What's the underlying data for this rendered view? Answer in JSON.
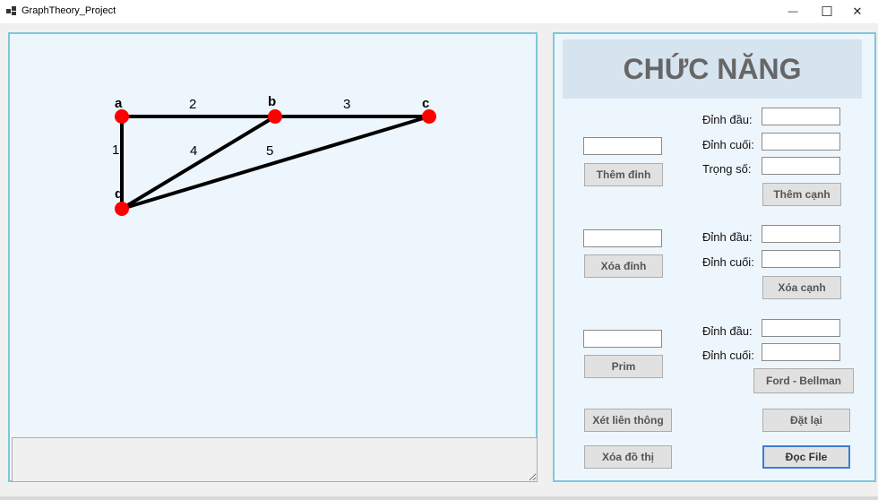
{
  "window": {
    "title": "GraphTheory_Project",
    "minimize_glyph": "—",
    "maximize_glyph": "☐",
    "close_glyph": "✕"
  },
  "graph": {
    "vertices": [
      {
        "id": "a",
        "label": "a"
      },
      {
        "id": "b",
        "label": "b"
      },
      {
        "id": "c",
        "label": "c"
      },
      {
        "id": "d",
        "label": "d"
      }
    ],
    "edges": [
      {
        "from": "a",
        "to": "b",
        "weight": "2"
      },
      {
        "from": "b",
        "to": "c",
        "weight": "3"
      },
      {
        "from": "a",
        "to": "d",
        "weight": "1"
      },
      {
        "from": "b",
        "to": "d",
        "weight": "4"
      },
      {
        "from": "c",
        "to": "d",
        "weight": "5"
      }
    ],
    "vertex_color": "#ff0000",
    "edge_color": "#000000"
  },
  "status_box": {
    "value": ""
  },
  "panel": {
    "header": "CHỨC NĂNG",
    "add_vertex": {
      "input": "",
      "button": "Thêm đỉnh"
    },
    "add_edge": {
      "start_label": "Đỉnh đầu:",
      "end_label": "Đỉnh cuối:",
      "weight_label": "Trọng số:",
      "start": "",
      "end": "",
      "weight": "",
      "button": "Thêm cạnh"
    },
    "delete_vertex": {
      "input": "",
      "button": "Xóa đỉnh"
    },
    "delete_edge": {
      "start_label": "Đỉnh đầu:",
      "end_label": "Đỉnh cuối:",
      "start": "",
      "end": "",
      "button": "Xóa cạnh"
    },
    "prim": {
      "input": "",
      "button": "Prim"
    },
    "ford_bellman": {
      "start_label": "Đỉnh đầu:",
      "end_label": "Đỉnh cuối:",
      "start": "",
      "end": "",
      "button": "Ford - Bellman"
    },
    "connectivity_button": "Xét liên thông",
    "reset_button": "Đặt lại",
    "delete_graph_button": "Xóa đồ thị",
    "read_file_button": "Đọc File"
  },
  "colors": {
    "panel_border": "#7ec8da",
    "panel_bg": "#eef6fd",
    "header_bg": "#d6e4f0"
  }
}
